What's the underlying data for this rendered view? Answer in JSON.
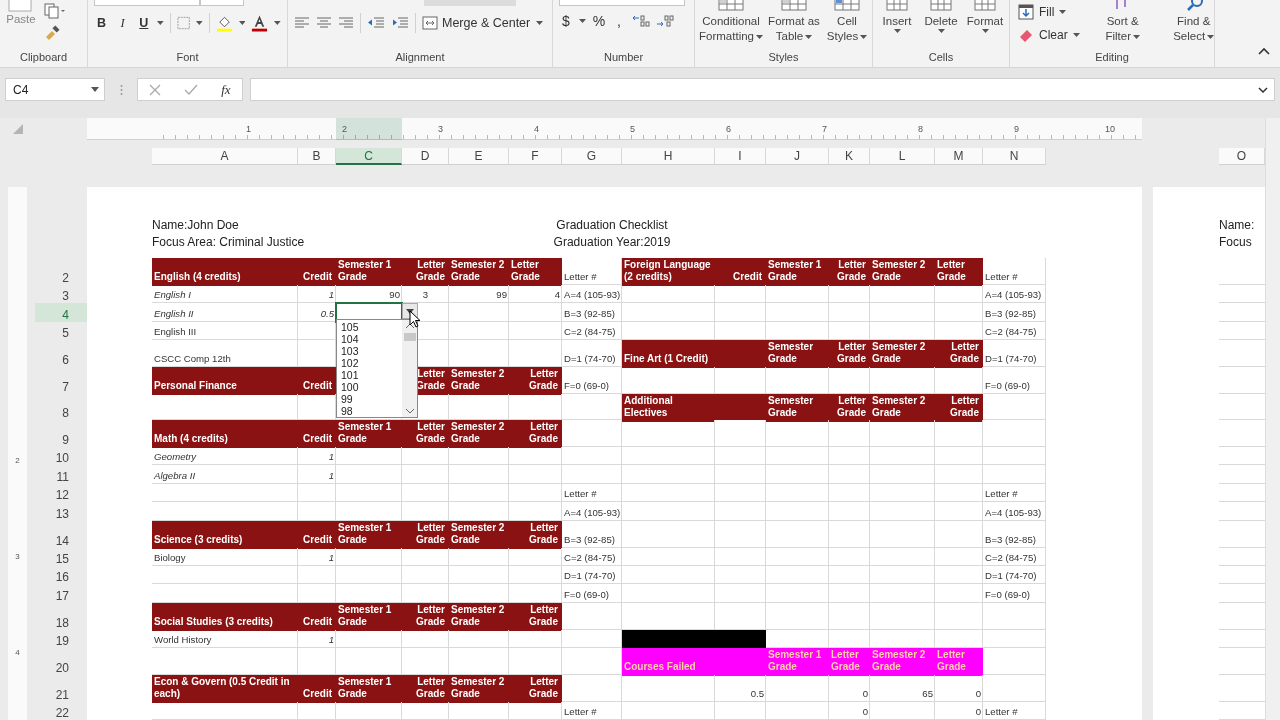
{
  "ribbon": {
    "paste": "Paste",
    "font_buttons": [
      "B",
      "I",
      "U"
    ],
    "merge": "Merge & Center",
    "number_buttons": [
      "$",
      "%",
      ","
    ],
    "styles": [
      "Conditional Formatting",
      "Format as Table",
      "Cell Styles"
    ],
    "cells": [
      "Insert",
      "Delete",
      "Format"
    ],
    "fill": "Fill",
    "clear": "Clear",
    "sort_filter": "Sort & Filter",
    "find_select": "Find & Select",
    "groups": [
      "Clipboard",
      "Font",
      "Alignment",
      "Number",
      "Styles",
      "Cells",
      "Editing"
    ]
  },
  "formula_bar": {
    "name_box": "C4",
    "function_label": "fx"
  },
  "ruler": {
    "labels": [
      "1",
      "2",
      "3",
      "4",
      "5",
      "6",
      "7",
      "8",
      "9",
      "10"
    ]
  },
  "vertical_ruler": {
    "labels": [
      "2",
      "3",
      "4"
    ]
  },
  "columns": [
    {
      "label": "A",
      "selected": false
    },
    {
      "label": "B",
      "selected": false
    },
    {
      "label": "C",
      "selected": true
    },
    {
      "label": "D",
      "selected": false
    },
    {
      "label": "E",
      "selected": false
    },
    {
      "label": "F",
      "selected": false
    },
    {
      "label": "G",
      "selected": false
    },
    {
      "label": "H",
      "selected": false
    },
    {
      "label": "I",
      "selected": false
    },
    {
      "label": "J",
      "selected": false
    },
    {
      "label": "K",
      "selected": false
    },
    {
      "label": "L",
      "selected": false
    },
    {
      "label": "M",
      "selected": false
    },
    {
      "label": "N",
      "selected": false
    }
  ],
  "page": {
    "name": "Name:John Doe",
    "focus": "Focus Area: Criminal Justice",
    "title": "Graduation Checklist",
    "year": "Graduation Year:2019"
  },
  "rows": [
    {
      "number": "2",
      "selected": false,
      "cells": [
        {
          "kind": "heading",
          "text": "English (4 credits)",
          "color": "#8b1212"
        },
        {
          "kind": "heading_right",
          "text": "Credit",
          "color": "#8b1212"
        },
        {
          "kind": "heading",
          "text": "Semester 1 Grade",
          "color": "#8b1212"
        },
        {
          "kind": "heading_right",
          "text": "Letter Grade",
          "color": "#8b1212"
        },
        {
          "kind": "heading",
          "text": "Semester 2 Grade",
          "color": "#8b1212"
        },
        {
          "kind": "heading",
          "text": "Letter Grade",
          "color": "#8b1212"
        },
        {
          "kind": "label",
          "text": "Letter #"
        },
        {
          "kind": "heading",
          "text": "Foreign Language (2 credits)",
          "color": "#8b1212"
        },
        {
          "kind": "heading_right",
          "text": "Credit",
          "color": "#8b1212"
        },
        {
          "kind": "heading",
          "text": "Semester 1 Grade",
          "color": "#8b1212"
        },
        {
          "kind": "heading_right",
          "text": "Letter Grade",
          "color": "#8b1212"
        },
        {
          "kind": "heading",
          "text": "Semester 2 Grade",
          "color": "#8b1212"
        },
        {
          "kind": "heading",
          "text": "Letter Grade",
          "color": "#8b1212"
        },
        {
          "kind": "label",
          "text": "Letter #"
        }
      ]
    },
    {
      "number": "3",
      "selected": false,
      "cells": [
        {
          "kind": "italic_label",
          "text": "English I"
        },
        {
          "kind": "italic_number",
          "text": "1"
        },
        {
          "kind": "number",
          "text": "90"
        },
        {
          "kind": "centered",
          "text": "3"
        },
        {
          "kind": "number",
          "text": "99"
        },
        {
          "kind": "number",
          "text": "4"
        },
        {
          "kind": "label",
          "text": "A=4 (105-93)"
        },
        {},
        {},
        {},
        {},
        {},
        {},
        {
          "kind": "label",
          "text": "A=4 (105-93)"
        }
      ]
    },
    {
      "number": "4",
      "selected": true,
      "cells": [
        {
          "kind": "italic_label",
          "text": "English II"
        },
        {
          "kind": "italic_number",
          "text": "0.5"
        },
        {
          "kind": "covered"
        },
        {},
        {},
        {},
        {
          "kind": "label",
          "text": "B=3 (92-85)"
        },
        {},
        {},
        {},
        {},
        {},
        {},
        {
          "kind": "label",
          "text": "B=3 (92-85)"
        }
      ]
    },
    {
      "number": "5",
      "selected": false,
      "cells": [
        {
          "kind": "label",
          "text": "English III"
        },
        {},
        {
          "kind": "covered"
        },
        {},
        {},
        {},
        {
          "kind": "label",
          "text": "C=2 (84-75)"
        },
        {},
        {},
        {},
        {},
        {},
        {},
        {
          "kind": "label",
          "text": "C=2 (84-75)"
        }
      ]
    },
    {
      "number": "6",
      "selected": false,
      "cells": [
        {
          "kind": "label",
          "text": "CSCC Comp 12th"
        },
        {},
        {
          "kind": "covered"
        },
        {},
        {},
        {},
        {
          "kind": "label",
          "text": "D=1 (74-70)"
        },
        {
          "kind": "heading_wide",
          "text": "Fine Art (1 Credit)",
          "color": "#8b1212"
        },
        {
          "kind": "covered"
        },
        {
          "kind": "heading",
          "text": "Semester Grade",
          "color": "#8b1212"
        },
        {
          "kind": "heading_right",
          "text": "Letter Grade",
          "color": "#8b1212"
        },
        {
          "kind": "heading",
          "text": "Semester 2 Grade",
          "color": "#8b1212"
        },
        {
          "kind": "heading_right",
          "text": "Letter Grade",
          "color": "#8b1212"
        },
        {
          "kind": "label",
          "text": "D=1 (74-70)"
        }
      ]
    },
    {
      "number": "7",
      "selected": false,
      "cells": [
        {
          "kind": "heading",
          "text": "Personal Finance",
          "color": "#8b1212"
        },
        {
          "kind": "heading_right",
          "text": "Credit",
          "color": "#8b1212"
        },
        {
          "kind": "covered"
        },
        {
          "kind": "heading_right",
          "text": "Letter Grade",
          "color": "#8b1212"
        },
        {
          "kind": "heading",
          "text": "Semester 2 Grade",
          "color": "#8b1212"
        },
        {
          "kind": "heading_right",
          "text": "Letter Grade",
          "color": "#8b1212"
        },
        {
          "kind": "label",
          "text": "F=0 (69-0)"
        },
        {},
        {},
        {},
        {},
        {},
        {},
        {
          "kind": "label",
          "text": "F=0 (69-0)"
        }
      ]
    },
    {
      "number": "8",
      "selected": false,
      "cells": [
        {},
        {},
        {},
        {},
        {},
        {},
        {},
        {
          "kind": "heading",
          "text": "Additional Electives",
          "color": "#8b1212"
        },
        {
          "color": "#8b1212"
        },
        {
          "kind": "heading",
          "text": "Semester Grade",
          "color": "#8b1212"
        },
        {
          "kind": "heading_right",
          "text": "Letter Grade",
          "color": "#8b1212"
        },
        {
          "kind": "heading",
          "text": "Semester 2 Grade",
          "color": "#8b1212"
        },
        {
          "kind": "heading_right",
          "text": "Letter Grade",
          "color": "#8b1212"
        },
        {}
      ]
    },
    {
      "number": "9",
      "selected": false,
      "cells": [
        {
          "kind": "heading",
          "text": "Math (4 credits)",
          "color": "#8b1212"
        },
        {
          "kind": "heading_right",
          "text": "Credit",
          "color": "#8b1212"
        },
        {
          "kind": "heading",
          "text": "Semester 1 Grade",
          "color": "#8b1212"
        },
        {
          "kind": "heading_right",
          "text": "Letter Grade",
          "color": "#8b1212"
        },
        {
          "kind": "heading",
          "text": "Semester 2 Grade",
          "color": "#8b1212"
        },
        {
          "kind": "heading_right",
          "text": "Letter Grade",
          "color": "#8b1212"
        },
        {},
        {},
        {},
        {},
        {},
        {},
        {},
        {}
      ]
    },
    {
      "number": "10",
      "selected": false,
      "cells": [
        {
          "kind": "italic_label",
          "text": "Geometry"
        },
        {
          "kind": "italic_number",
          "text": "1"
        },
        {},
        {},
        {},
        {},
        {},
        {},
        {},
        {},
        {},
        {},
        {},
        {}
      ]
    },
    {
      "number": "11",
      "selected": false,
      "cells": [
        {
          "kind": "italic_label",
          "text": "Algebra II"
        },
        {
          "kind": "italic_number",
          "text": "1"
        },
        {},
        {},
        {},
        {},
        {},
        {},
        {},
        {},
        {},
        {},
        {},
        {}
      ]
    },
    {
      "number": "12",
      "selected": false,
      "cells": [
        {},
        {},
        {},
        {},
        {},
        {},
        {
          "kind": "label",
          "text": "Letter #"
        },
        {},
        {},
        {},
        {},
        {},
        {},
        {
          "kind": "label",
          "text": "Letter #"
        }
      ]
    },
    {
      "number": "13",
      "selected": false,
      "cells": [
        {},
        {},
        {},
        {},
        {},
        {},
        {
          "kind": "label",
          "text": "A=4 (105-93)"
        },
        {},
        {},
        {},
        {},
        {},
        {},
        {
          "kind": "label",
          "text": "A=4 (105-93)"
        }
      ]
    },
    {
      "number": "14",
      "selected": false,
      "cells": [
        {
          "kind": "heading",
          "text": "Science (3 credits)",
          "color": "#8b1212"
        },
        {
          "kind": "heading_right",
          "text": "Credit",
          "color": "#8b1212"
        },
        {
          "kind": "heading",
          "text": "Semester 1 Grade",
          "color": "#8b1212"
        },
        {
          "kind": "heading_right",
          "text": "Letter Grade",
          "color": "#8b1212"
        },
        {
          "kind": "heading",
          "text": "Semester 2 Grade",
          "color": "#8b1212"
        },
        {
          "kind": "heading_right",
          "text": "Letter Grade",
          "color": "#8b1212"
        },
        {
          "kind": "label",
          "text": "B=3 (92-85)"
        },
        {},
        {},
        {},
        {},
        {},
        {},
        {
          "kind": "label",
          "text": "B=3 (92-85)"
        }
      ]
    },
    {
      "number": "15",
      "selected": false,
      "cells": [
        {
          "kind": "label",
          "text": "Biology"
        },
        {
          "kind": "italic_number",
          "text": "1"
        },
        {},
        {},
        {},
        {},
        {
          "kind": "label",
          "text": "C=2 (84-75)"
        },
        {},
        {},
        {},
        {},
        {},
        {},
        {
          "kind": "label",
          "text": "C=2 (84-75)"
        }
      ]
    },
    {
      "number": "16",
      "selected": false,
      "cells": [
        {},
        {},
        {},
        {},
        {},
        {},
        {
          "kind": "label",
          "text": "D=1 (74-70)"
        },
        {},
        {},
        {},
        {},
        {},
        {},
        {
          "kind": "label",
          "text": "D=1 (74-70)"
        }
      ]
    },
    {
      "number": "17",
      "selected": false,
      "cells": [
        {},
        {},
        {},
        {},
        {},
        {},
        {
          "kind": "label",
          "text": "F=0 (69-0)"
        },
        {},
        {},
        {},
        {},
        {},
        {},
        {
          "kind": "label",
          "text": "F=0 (69-0)"
        }
      ]
    },
    {
      "number": "18",
      "selected": false,
      "cells": [
        {
          "kind": "heading",
          "text": "Social Studies (3 credits)",
          "color": "#8b1212"
        },
        {
          "kind": "heading_right",
          "text": "Credit",
          "color": "#8b1212"
        },
        {
          "kind": "heading",
          "text": "Semester 1 Grade",
          "color": "#8b1212"
        },
        {
          "kind": "heading_right",
          "text": "Letter Grade",
          "color": "#8b1212"
        },
        {
          "kind": "heading",
          "text": "Semester 2 Grade",
          "color": "#8b1212"
        },
        {
          "kind": "heading_right",
          "text": "Letter Grade",
          "color": "#8b1212"
        },
        {},
        {},
        {},
        {},
        {},
        {},
        {},
        {}
      ]
    },
    {
      "number": "19",
      "selected": false,
      "cells": [
        {
          "kind": "label",
          "text": "World History"
        },
        {
          "kind": "italic_number",
          "text": "1"
        },
        {},
        {},
        {},
        {},
        {},
        {
          "color": "#000000"
        },
        {
          "color": "#000000"
        },
        {},
        {},
        {},
        {},
        {}
      ]
    },
    {
      "number": "20",
      "selected": false,
      "cells": [
        {},
        {},
        {},
        {},
        {},
        {},
        {},
        {
          "kind": "heading_wide",
          "text": "Courses Failed",
          "color": "#ff00ff"
        },
        {
          "kind": "covered"
        },
        {
          "kind": "heading",
          "text": "Semester 1 Grade",
          "color": "#ff00ff"
        },
        {
          "kind": "heading",
          "text": "Letter Grade",
          "color": "#ff00ff"
        },
        {
          "kind": "heading",
          "text": "Semester 2 Grade",
          "color": "#ff00ff"
        },
        {
          "kind": "heading",
          "text": "Letter Grade",
          "color": "#ff00ff"
        },
        {}
      ]
    },
    {
      "number": "21",
      "selected": false,
      "cells": [
        {
          "kind": "heading",
          "text": "Econ & Govern (0.5 Credit in each)",
          "color": "#8b1212"
        },
        {
          "kind": "heading_right",
          "text": "Credit",
          "color": "#8b1212"
        },
        {
          "kind": "heading",
          "text": "Semester 1 Grade",
          "color": "#8b1212"
        },
        {
          "kind": "heading_right",
          "text": "Letter Grade",
          "color": "#8b1212"
        },
        {
          "kind": "heading",
          "text": "Semester 2 Grade",
          "color": "#8b1212"
        },
        {
          "kind": "heading_right",
          "text": "Letter Grade",
          "color": "#8b1212"
        },
        {},
        {},
        {
          "kind": "number",
          "text": "0.5"
        },
        {},
        {
          "kind": "number",
          "text": "0"
        },
        {
          "kind": "number",
          "text": "65"
        },
        {
          "kind": "number",
          "text": "0"
        },
        {}
      ]
    },
    {
      "number": "22",
      "selected": false,
      "cells": [
        {},
        {},
        {},
        {},
        {},
        {},
        {
          "kind": "label",
          "text": "Letter #"
        },
        {},
        {},
        {},
        {
          "kind": "number",
          "text": "0"
        },
        {},
        {
          "kind": "number",
          "text": "0"
        },
        {
          "kind": "label",
          "text": "Letter #"
        }
      ]
    }
  ],
  "dropdown": {
    "items": [
      "105",
      "104",
      "103",
      "102",
      "101",
      "100",
      "99",
      "98"
    ]
  },
  "next_page": {
    "column": "O",
    "name": "Name:",
    "focus": "Focus"
  }
}
